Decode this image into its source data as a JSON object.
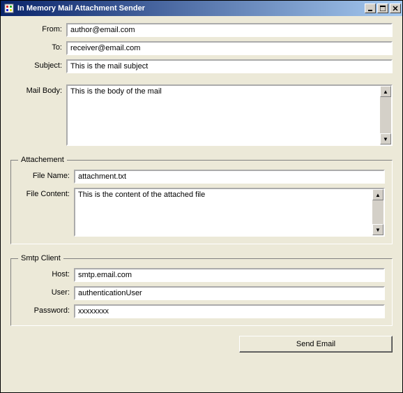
{
  "window": {
    "title": "In Memory Mail Attachment Sender"
  },
  "mail": {
    "from_label": "From:",
    "from_value": "author@email.com",
    "to_label": "To:",
    "to_value": "receiver@email.com",
    "subject_label": "Subject:",
    "subject_value": "This is the mail subject",
    "body_label": "Mail Body:",
    "body_value": "This is the body of the mail"
  },
  "attachment": {
    "legend": "Attachement",
    "filename_label": "File Name:",
    "filename_value": "attachment.txt",
    "filecontent_label": "File Content:",
    "filecontent_value": "This is the content of the attached file"
  },
  "smtp": {
    "legend": "Smtp Client",
    "host_label": "Host:",
    "host_value": "smtp.email.com",
    "user_label": "User:",
    "user_value": "authenticationUser",
    "password_label": "Password:",
    "password_value": "xxxxxxxx"
  },
  "actions": {
    "send_label": "Send Email"
  }
}
